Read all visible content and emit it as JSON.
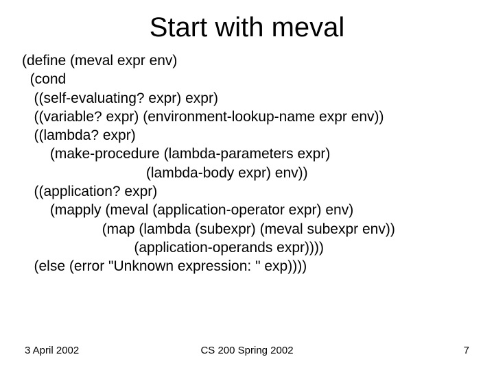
{
  "title": "Start with meval",
  "code": "(define (meval expr env)\n  (cond\n   ((self-evaluating? expr) expr)\n   ((variable? expr) (environment-lookup-name expr env))\n   ((lambda? expr)\n       (make-procedure (lambda-parameters expr)\n                               (lambda-body expr) env))\n   ((application? expr)\n       (mapply (meval (application-operator expr) env)\n                    (map (lambda (subexpr) (meval subexpr env))\n                            (application-operands expr))))\n   (else (error \"Unknown expression: \" exp))))",
  "footer": {
    "date": "3 April 2002",
    "course": "CS 200 Spring 2002",
    "page": "7"
  }
}
